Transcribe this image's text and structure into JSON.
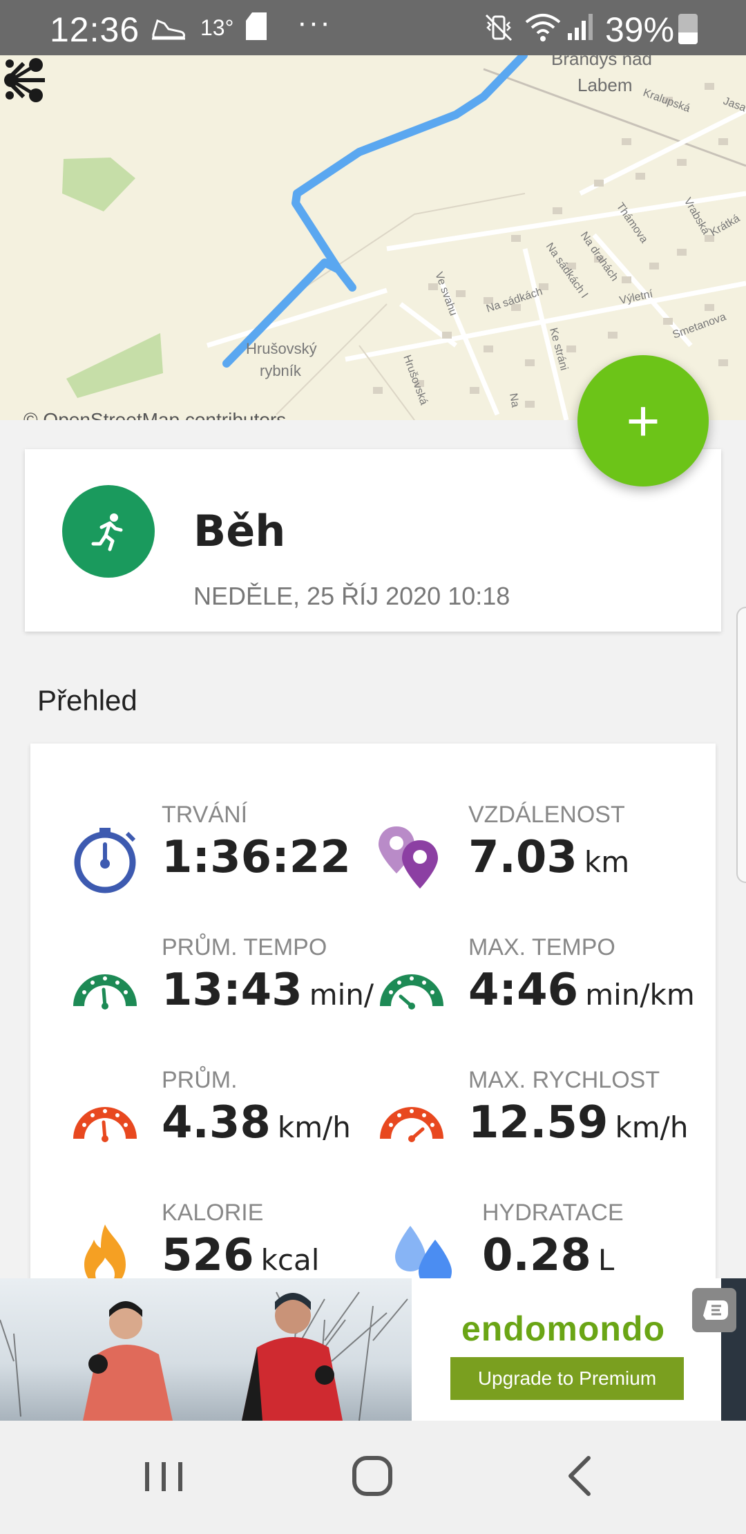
{
  "status_bar": {
    "time": "12:36",
    "temperature": "13°",
    "more": "···",
    "battery": "39%",
    "battery_level": 0.39
  },
  "map": {
    "credit": "© OpenStreetMap contributors",
    "labels": {
      "town1": "Brandýs nad",
      "town2": "Labem",
      "pond1": "Hrušovský",
      "pond2": "rybník",
      "s1": "Kralupská",
      "s2": "Jasa",
      "s3": "Thámova",
      "s4": "Vrabská",
      "s5": "Krátká",
      "s6": "Na drahách",
      "s7": "Na sádkách I",
      "s8": "Na sádkách",
      "s9": "Výletní",
      "s10": "Ve svahu",
      "s11": "Ke stráni",
      "s12": "Smetanova",
      "s13": "Hrušovská",
      "s14": "Na"
    }
  },
  "fab": {
    "label": "+"
  },
  "workout": {
    "sport": "Běh",
    "date": "NEDĚLE, 25 ŘÍJ 2020 10:18"
  },
  "overview": {
    "title": "Přehled",
    "stats": [
      {
        "label": "TRVÁNÍ",
        "value": "1:36:22",
        "unit": ""
      },
      {
        "label": "VZDÁLENOST",
        "value": "7.03",
        "unit": "km"
      },
      {
        "label": "PRŮM. TEMPO",
        "value": "13:43",
        "unit": "min/"
      },
      {
        "label": "MAX. TEMPO",
        "value": "4:46",
        "unit": "min/km"
      },
      {
        "label": "PRŮM.",
        "value": "4.38",
        "unit": "km/h"
      },
      {
        "label": "MAX. RYCHLOST",
        "value": "12.59",
        "unit": "km/h"
      },
      {
        "label": "KALORIE",
        "value": "526",
        "unit": "kcal"
      },
      {
        "label": "HYDRATACE",
        "value": "0.28",
        "unit": "L"
      }
    ]
  },
  "ad": {
    "brand": "endomondo",
    "cta": "Upgrade to Premium"
  },
  "colors": {
    "accent_green": "#6cc418",
    "sport_green": "#1a9a5d",
    "route_blue": "#5aa7f0",
    "stopwatch_blue": "#3d5ab0",
    "pin_purple": "#8c3fa3",
    "tempo_green": "#1d8a55",
    "speed_red": "#e8481f",
    "calorie_orange": "#f5a023",
    "water_blue": "#4b8df2"
  }
}
